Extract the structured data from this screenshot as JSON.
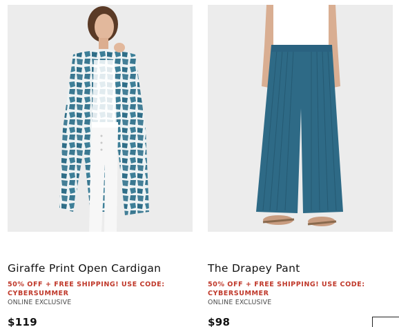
{
  "products": [
    {
      "name": "Giraffe Print Open Cardigan",
      "promo": "50% OFF + FREE SHIPPING! USE CODE: CYBERSUMMER",
      "badge": "ONLINE EXCLUSIVE",
      "price": "$119"
    },
    {
      "name": "The Drapey Pant",
      "promo": "50% OFF + FREE SHIPPING! USE CODE: CYBERSUMMER",
      "badge": "ONLINE EXCLUSIVE",
      "price": "$98"
    }
  ],
  "colors": {
    "promo": "#c0392b",
    "background": "#ececec",
    "teal": "#2e6a86"
  }
}
